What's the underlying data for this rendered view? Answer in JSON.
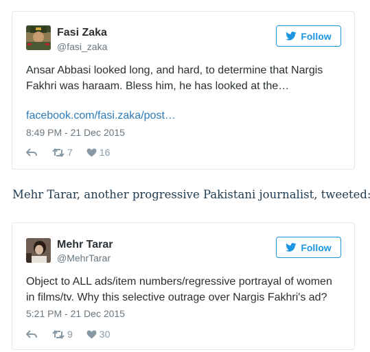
{
  "tweets": [
    {
      "name": "Fasi Zaka",
      "handle": "@fasi_zaka",
      "follow_label": "Follow",
      "text_line1": "Ansar Abbasi looked long, and hard, to determine that Nargis",
      "text_line2": "Fakhri was haraam. Bless him, he has looked at the…",
      "link": "facebook.com/fasi.zaka/post…",
      "timestamp": "8:49 PM - 21 Dec 2015",
      "retweets": "7",
      "likes": "16"
    },
    {
      "name": "Mehr Tarar",
      "handle": "@MehrTarar",
      "follow_label": "Follow",
      "text_line1": "Object to ALL ads/item numbers/regressive portrayal of women",
      "text_line2": "in films/tv. Why this selective outrage over Nargis Fakhri's ad?",
      "timestamp": "5:21 PM - 21 Dec 2015",
      "retweets": "9",
      "likes": "30"
    }
  ],
  "caption": "Mehr Tarar, another progressive Pakistani journalist, tweeted:",
  "icons": {
    "follow": "twitter-bird-icon",
    "reply": "reply-icon",
    "retweet": "retweet-icon",
    "like": "heart-icon"
  },
  "colors": {
    "accent": "#1b95e0",
    "link": "#2b7bb9",
    "muted": "#8899a6",
    "text": "#292f33",
    "border": "#e1e8ed",
    "caption": "#1f3a4f"
  }
}
